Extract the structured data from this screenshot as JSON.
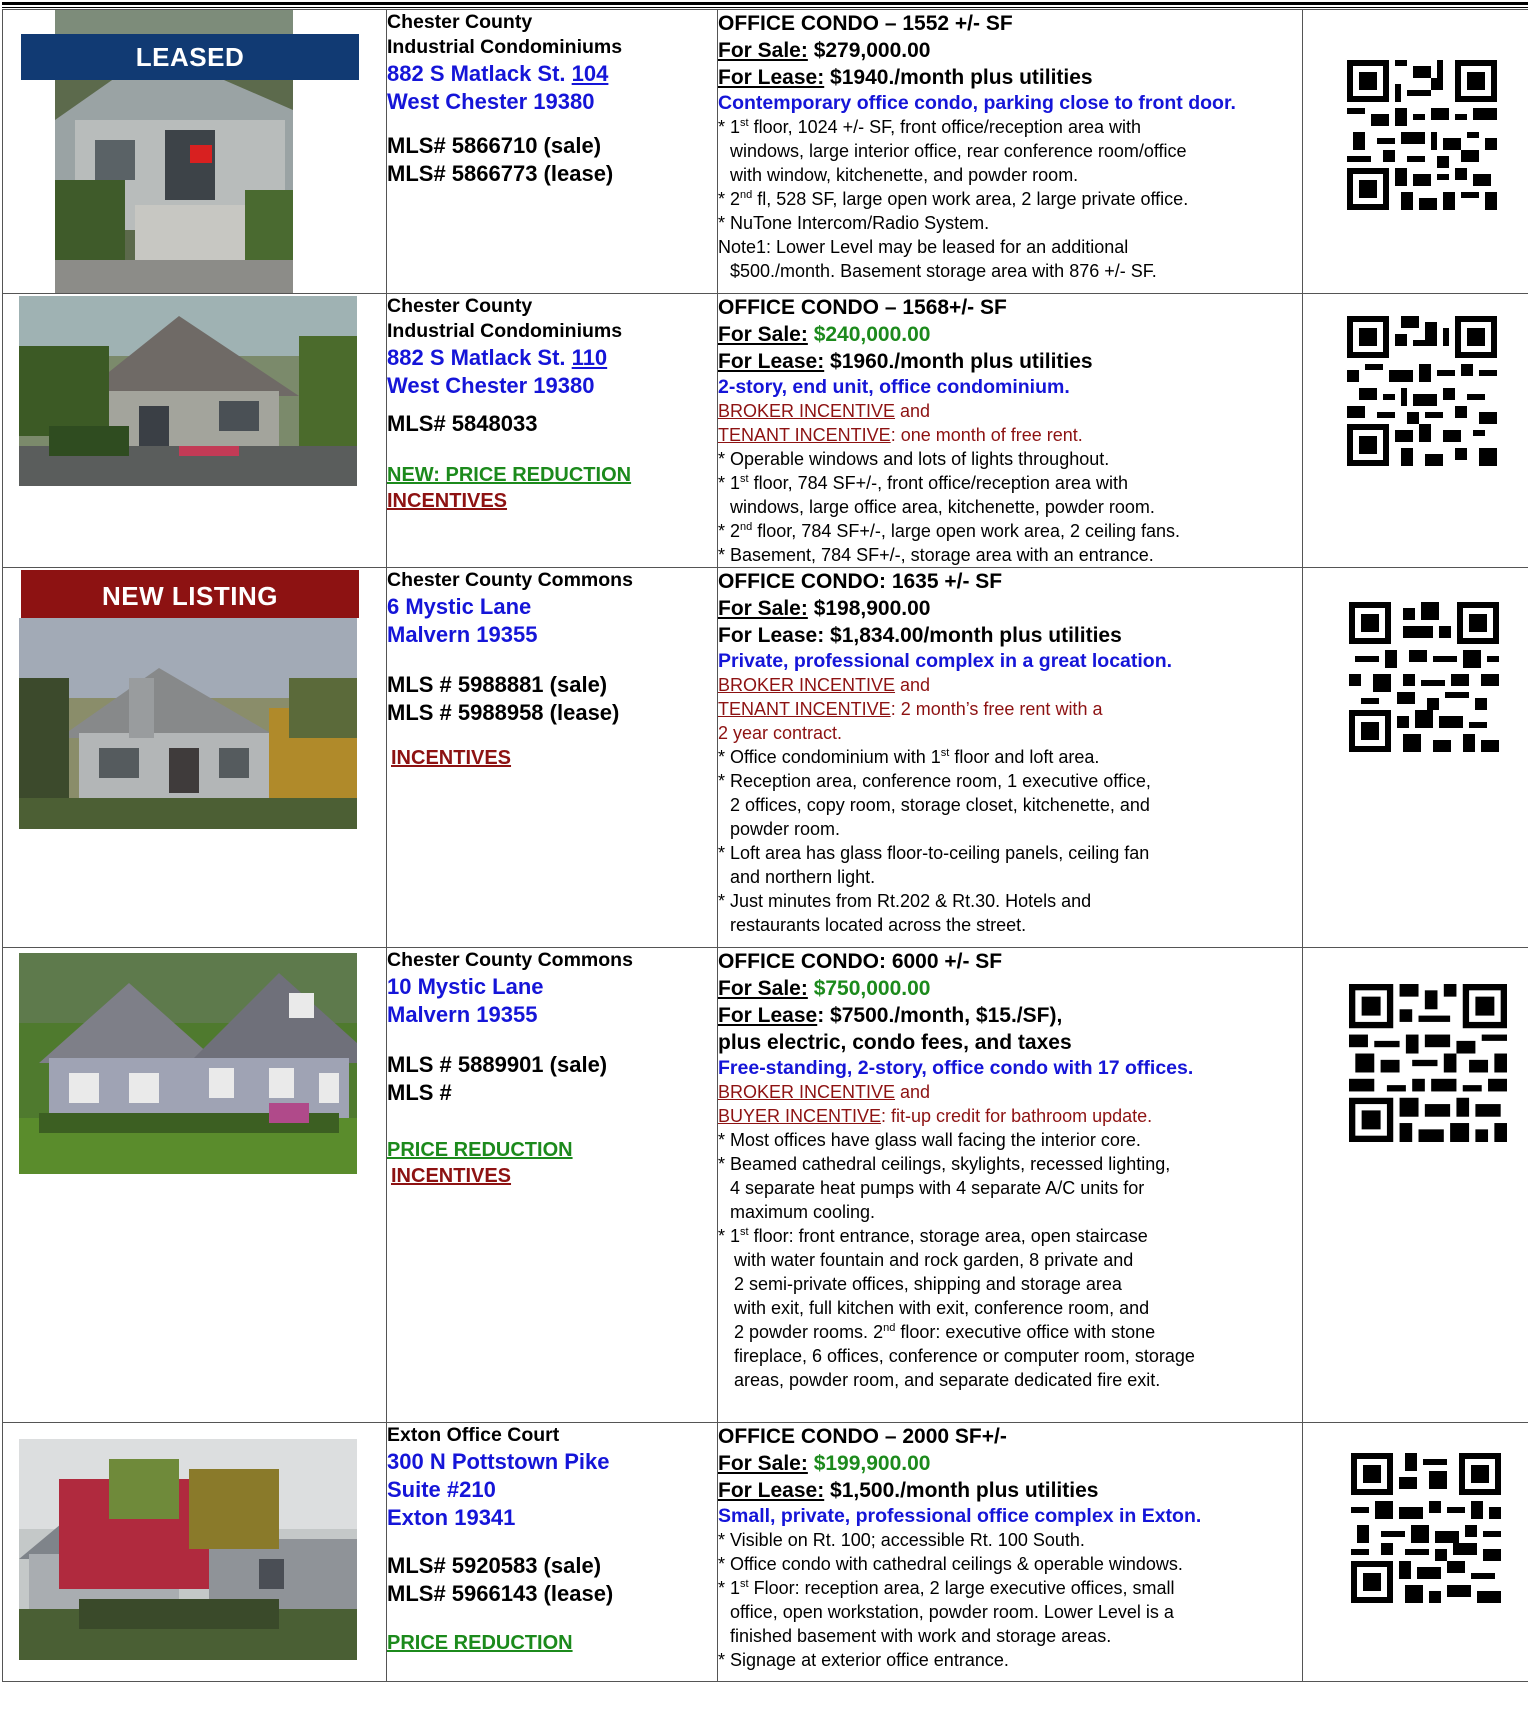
{
  "listings": [
    {
      "banner": "LEASED",
      "complex": "Chester County Industrial Condominiums",
      "complex_line1": "Chester County",
      "complex_line2": "Industrial Condominiums",
      "address1": "882 S Matlack St.",
      "unit": "104",
      "address2": "West Chester 19380",
      "mls": [
        "MLS# 5866710 (sale)",
        "MLS# 5866773 (lease)"
      ],
      "heading": "OFFICE CONDO – 1552 +/- SF",
      "sale_label": "For Sale:",
      "sale_price": "$279,000.00",
      "lease_label": "For Lease:",
      "lease_price": "$1940./month plus utilities",
      "tagline": "Contemporary office condo, parking close to front door.",
      "lines": [
        "* 1st floor, 1024 +/- SF, front office/reception area with",
        "windows, large interior office, rear conference room/office",
        "with window, kitchenette, and powder room.",
        "* 2nd fl, 528 SF, large open work area, 2 large private office.",
        "* NuTone Intercom/Radio System.",
        "Note1:  Lower Level may be leased for an additional",
        "$500./month.  Basement storage area with 876 +/- SF."
      ]
    },
    {
      "complex_line1": "Chester County",
      "complex_line2": "Industrial Condominiums",
      "address1": "882 S Matlack St.",
      "unit": "110",
      "address2": "West Chester 19380",
      "mls": [
        "MLS# 5848033"
      ],
      "tag_green": "NEW: PRICE REDUCTION",
      "tag_red": "INCENTIVES",
      "heading": "OFFICE CONDO – 1568+/- SF",
      "sale_label": "For Sale:",
      "sale_price": "$240,000.00",
      "lease_label": "For Lease:",
      "lease_price": "$1960./month plus utilities",
      "tagline": "2-story, end unit, office condominium.",
      "broker_incentive": "BROKER INCENTIVE",
      "broker_and": " and",
      "tenant_incentive": "TENANT INCENTIVE",
      "tenant_text": ": one month of free rent.",
      "lines": [
        "* Operable windows and lots of lights throughout.",
        "* 1st floor, 784 SF+/-, front office/reception area with",
        "windows, large office area, kitchenette, powder room.",
        "* 2nd floor, 784 SF+/-, large open work area, 2 ceiling fans.",
        "* Basement, 784 SF+/-, storage area with an entrance."
      ]
    },
    {
      "banner": "NEW LISTING",
      "complex_line1": "Chester County Commons",
      "address1": "6 Mystic Lane",
      "address2": "Malvern  19355",
      "mls": [
        "MLS #  5988881 (sale)",
        "MLS #  5988958 (lease)"
      ],
      "tag_red": "INCENTIVES",
      "heading": "OFFICE CONDO:   1635 +/-  SF",
      "sale_label": "For Sale:",
      "sale_price": " $198,900.00",
      "lease_label": "For Lease:",
      "lease_price": " $1,834.00/month plus utilities",
      "tagline": "Private, professional complex in a great location.",
      "broker_incentive": "BROKER INCENTIVE",
      "broker_and": "  and",
      "tenant_incentive": "TENANT INCENTIVE",
      "tenant_text": ": 2 month’s free rent with a",
      "tenant_text2": "2 year contract.",
      "lines": [
        "* Office condominium with 1st floor and loft area.",
        "* Reception area, conference room, 1 executive office,",
        "2 offices, copy room, storage closet, kitchenette, and",
        "powder room.",
        "* Loft area has glass floor-to-ceiling panels, ceiling fan",
        "and northern light.",
        "* Just minutes from Rt.202 & Rt.30.  Hotels and",
        "restaurants located across the street."
      ]
    },
    {
      "complex_line1": "Chester County Commons",
      "address1": "10 Mystic Lane",
      "address2": "Malvern  19355",
      "mls": [
        "MLS #  5889901 (sale)",
        "MLS #"
      ],
      "tag_green": "PRICE REDUCTION",
      "tag_red": "INCENTIVES",
      "heading": "OFFICE CONDO:   6000 +/-  SF",
      "sale_label": "For Sale:",
      "sale_price": " $750,000.00",
      "lease_label": "For Lease",
      "lease_price": ": $7500./month, $15./SF),",
      "lease_price2": "plus electric, condo fees, and taxes",
      "tagline": "Free-standing, 2-story, office condo with 17 offices.",
      "broker_incentive": "BROKER INCENTIVE",
      "broker_and": "  and",
      "tenant_incentive": "BUYER INCENTIVE",
      "tenant_text": ": fit-up credit for bathroom update.",
      "lines": [
        "* Most offices have glass wall facing the interior core.",
        "* Beamed cathedral ceilings, skylights, recessed lighting,",
        "4 separate heat pumps with 4 separate A/C units for",
        "maximum cooling.",
        "* 1st floor: front entrance, storage area, open staircase",
        "with water fountain and rock garden, 8 private and",
        "2 semi-private offices, shipping and storage area",
        "with exit, full kitchen with exit, conference room, and",
        "2 powder rooms.  2nd floor: executive office with stone",
        "fireplace, 6 offices, conference or computer room, storage",
        "areas, powder room, and separate dedicated fire exit."
      ]
    },
    {
      "complex_line1": "Exton Office Court",
      "address1": "300 N Pottstown Pike",
      "address_mid": "Suite #210",
      "address2": "Exton  19341",
      "mls": [
        "MLS#  5920583 (sale)",
        "MLS# 5966143 (lease)"
      ],
      "tag_green": "PRICE REDUCTION",
      "heading": "OFFICE CONDO –  2000 SF+/-",
      "sale_label": "For Sale:",
      "sale_price": " $199,900.00",
      "lease_label": "For Lease:",
      "lease_price": " $1,500./month plus utilities",
      "tagline": "Small, private, professional office complex in Exton.",
      "lines": [
        "* Visible on Rt. 100; accessible Rt. 100 South.",
        "* Office condo with cathedral ceilings & operable windows.",
        "* 1st Floor: reception area, 2 large executive offices, small",
        "office, open workstation, powder room.  Lower Level is a",
        "finished basement with work and storage areas.",
        "* Signage at exterior office entrance."
      ]
    }
  ],
  "colors": {
    "blue_text": "#1515d8",
    "green_text": "#1c8a1c",
    "red_text": "#8d1212",
    "leased_banner": "#113a73",
    "new_listing_banner": "#8d1212"
  },
  "icons": [
    "house-photo",
    "qr-code-icon"
  ]
}
